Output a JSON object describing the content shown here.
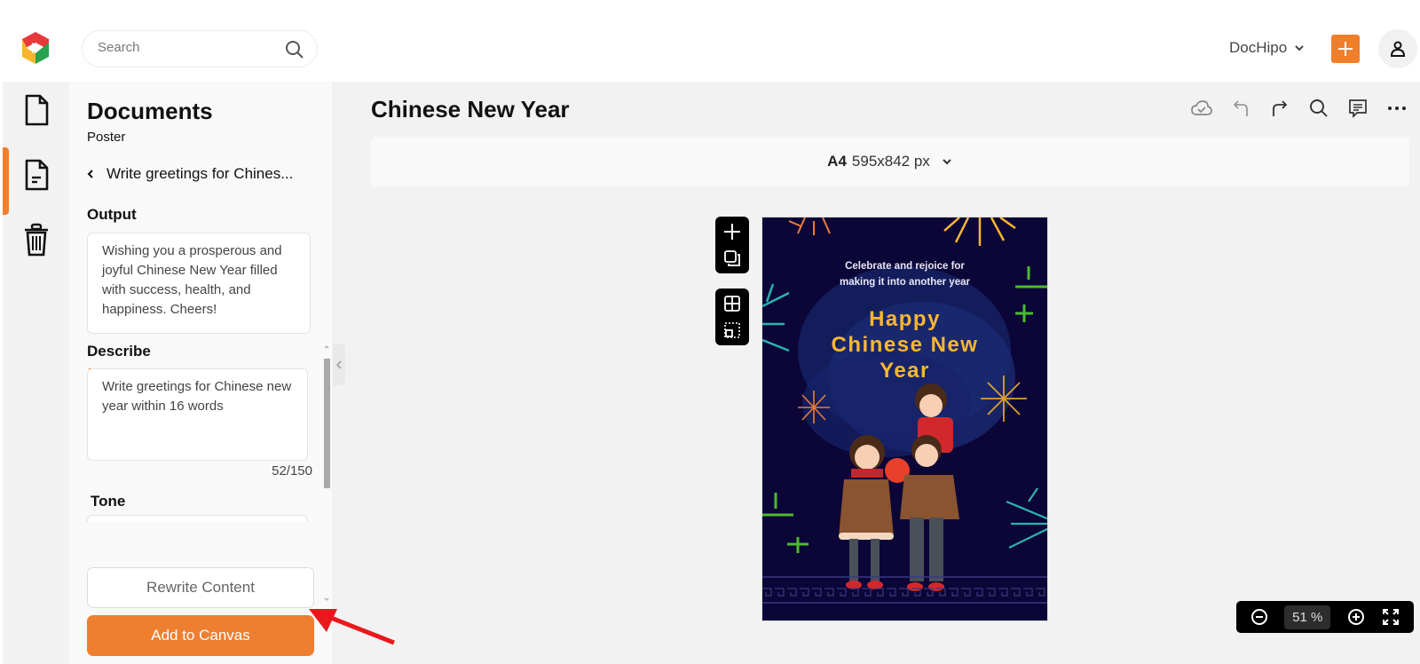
{
  "header": {
    "logo": "dochipo-logo",
    "search": {
      "placeholder": "Search",
      "value": ""
    },
    "account_label": "DocHipo",
    "add_button": "+",
    "user_icon": "user-icon"
  },
  "rail": {
    "items": [
      {
        "name": "documents",
        "icon": "file-icon",
        "active": false
      },
      {
        "name": "ai-writer",
        "icon": "file-text-icon",
        "active": true
      },
      {
        "name": "trash",
        "icon": "trash-icon",
        "active": false
      }
    ]
  },
  "panel": {
    "title": "Documents",
    "subtitle": "Poster",
    "back_label": "Write greetings for Chines...",
    "output_label": "Output",
    "output_text": "Wishing you a prosperous and joyful Chinese New Year filled with success, health, and happiness. Cheers!",
    "describe_label": "Describe",
    "describe_value": "Write greetings for Chinese new year within 16 words",
    "describe_counter": "52/150",
    "tone_label": "Tone",
    "rewrite_button": "Rewrite Content",
    "add_button": "Add to Canvas"
  },
  "editor": {
    "doc_title": "Chinese New Year",
    "toolbar": [
      "cloud-saved-icon",
      "undo-icon",
      "redo-icon",
      "search-icon",
      "comment-icon",
      "more-icon"
    ],
    "page_size_name": "A4",
    "page_size_dims": "595x842 px",
    "zoom_value": "51 %"
  },
  "poster": {
    "tagline_line1": "Celebrate and rejoice for",
    "tagline_line2": "making it into another year",
    "headline_line1": "Happy",
    "headline_line2": "Chinese New",
    "headline_line3": "Year",
    "colors": {
      "background": "#0b0637",
      "headline": "#f7b731"
    }
  },
  "colors": {
    "accent": "#ef7f30",
    "annotation_arrow": "#e8191c"
  }
}
